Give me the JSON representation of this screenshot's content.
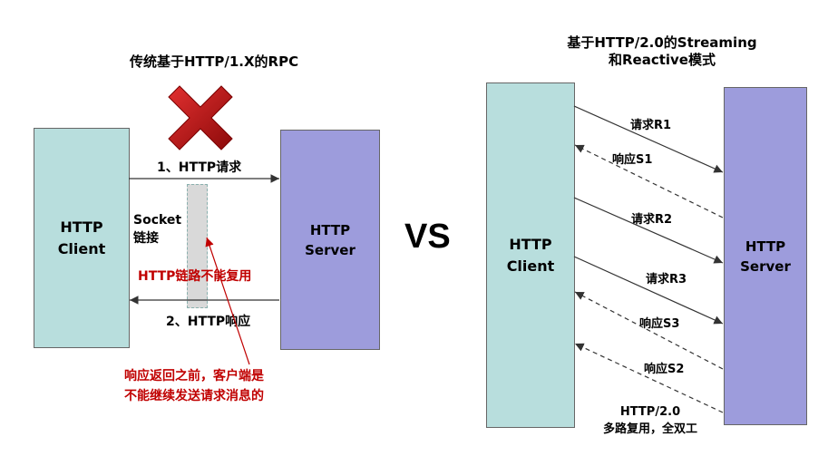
{
  "left": {
    "title": "传统基于HTTP/1.X的RPC",
    "client_label": "HTTP\nClient",
    "server_label": "HTTP\nServer",
    "request_label": "1、HTTP请求",
    "response_label": "2、HTTP响应",
    "socket_label": "Socket\n链接",
    "no_reuse_note": "HTTP链路不能复用",
    "blocking_note": "响应返回之前，客户端是\n不能继续发送请求消息的"
  },
  "vs_label": "VS",
  "right": {
    "title": "基于HTTP/2.0的Streaming\n和Reactive模式",
    "client_label": "HTTP\nClient",
    "server_label": "HTTP\nServer",
    "messages": [
      {
        "label": "请求R1",
        "kind": "request"
      },
      {
        "label": "响应S1",
        "kind": "response"
      },
      {
        "label": "请求R2",
        "kind": "request"
      },
      {
        "label": "请求R3",
        "kind": "request"
      },
      {
        "label": "响应S3",
        "kind": "response"
      },
      {
        "label": "响应S2",
        "kind": "response"
      }
    ],
    "footer": "HTTP/2.0\n多路复用，全双工"
  },
  "colors": {
    "client_fill": "#b8dedd",
    "server_fill": "#9d9cdc",
    "socket_fill": "#d9d9d9",
    "alert_red": "#c00000",
    "cross_red": "#b01010"
  },
  "icons": {
    "cross": "red-x-icon"
  }
}
